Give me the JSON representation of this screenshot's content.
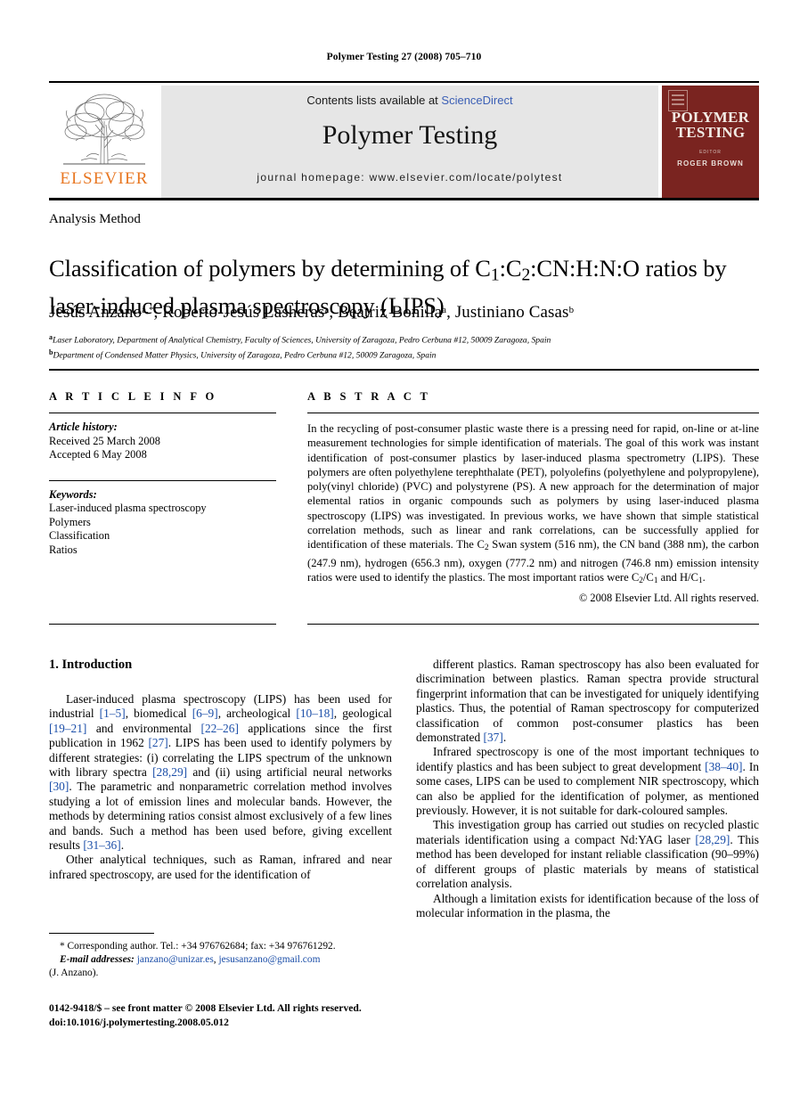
{
  "running_head": "Polymer Testing 27 (2008) 705–710",
  "masthead": {
    "contents_prefix": "Contents lists available at ",
    "sciencedirect": "ScienceDirect",
    "journal_name": "Polymer Testing",
    "homepage": "journal homepage: www.elsevier.com/locate/polytest",
    "publisher_wordmark": "ELSEVIER",
    "cover": {
      "title_line1": "POLYMER",
      "title_line2": "TESTING",
      "editor_label": "EDITOR",
      "editor": "ROGER BROWN"
    },
    "accent_link_color": "#3b5fb5",
    "elsevier_orange": "#E87722",
    "cover_color": "#7a2420"
  },
  "article": {
    "section_label": "Analysis Method",
    "title_part1": "Classification of polymers by determining of C",
    "title_sub1": "1",
    "title_part2": ":C",
    "title_sub2": "2",
    "title_part3": ":CN:H:N:O ratios by laser-induced plasma spectroscopy (LIPS)",
    "authors": [
      {
        "name": "Jesús Anzano",
        "marks": "a,*"
      },
      {
        "name": "Roberto-Jesús Lasheras",
        "marks": "a"
      },
      {
        "name": "Beatriz Bonilla",
        "marks": "a"
      },
      {
        "name": "Justiniano Casas",
        "marks": "b"
      }
    ],
    "affiliations": [
      {
        "mark": "a",
        "text": "Laser Laboratory, Department of Analytical Chemistry, Faculty of Sciences, University of Zaragoza, Pedro Cerbuna #12, 50009 Zaragoza, Spain"
      },
      {
        "mark": "b",
        "text": "Department of Condensed Matter Physics, University of Zaragoza, Pedro Cerbuna #12, 50009 Zaragoza, Spain"
      }
    ]
  },
  "info": {
    "heading": "A R T I C L E   I N F O",
    "history_label": "Article history:",
    "received": "Received 25 March 2008",
    "accepted": "Accepted 6 May 2008",
    "keywords_label": "Keywords:",
    "keywords": [
      "Laser-induced plasma spectroscopy",
      "Polymers",
      "Classification",
      "Ratios"
    ]
  },
  "abstract": {
    "heading": "A B S T R A C T",
    "p1_a": "In the recycling of post-consumer plastic waste there is a pressing need for rapid, on-line or at-line measurement technologies for simple identification of materials. The goal of this work was instant identification of post-consumer plastics by laser-induced plasma spectrometry (LIPS). These polymers are often polyethylene terephthalate (PET), polyolefins (polyethylene and polypropylene), poly(vinyl chloride) (PVC) and polystyrene (PS). A new approach for the determination of major elemental ratios in organic compounds such as polymers by using laser-induced plasma spectroscopy (LIPS) was investigated. In previous works, we have shown that simple statistical correlation methods, such as linear and rank correlations, can be successfully applied for identification of these materials. The C",
    "p1_sub1": "2",
    "p1_b": " Swan system (516 nm), the CN band (388 nm), the carbon (247.9 nm), hydrogen (656.3 nm), oxygen (777.2 nm) and nitrogen (746.8 nm) emission intensity ratios were used to identify the plastics. The most important ratios were C",
    "p1_sub2": "2",
    "p1_c": "/C",
    "p1_sub3": "1",
    "p1_d": " and H/C",
    "p1_sub4": "1",
    "p1_e": ".",
    "copyright": "© 2008 Elsevier Ltd. All rights reserved."
  },
  "body": {
    "intro_heading": "1. Introduction",
    "left": {
      "p1_a": "Laser-induced plasma spectroscopy (LIPS) has been used for industrial ",
      "p1_r1": "[1–5]",
      "p1_b": ", biomedical ",
      "p1_r2": "[6–9]",
      "p1_c": ", archeological ",
      "p1_r3": "[10–18]",
      "p1_d": ", geological ",
      "p1_r4": "[19–21]",
      "p1_e": " and environmental ",
      "p1_r5": "[22–26]",
      "p1_f": " applications since the first publication in 1962 ",
      "p1_r6": "[27]",
      "p1_g": ". LIPS has been used to identify polymers by different strategies: (i) correlating the LIPS spectrum of the unknown with library spectra ",
      "p1_r7": "[28,29]",
      "p1_h": " and (ii) using artificial neural networks ",
      "p1_r8": "[30]",
      "p1_i": ". The parametric and nonparametric correlation method involves studying a lot of emission lines and molecular bands. However, the methods by determining ratios consist almost exclusively of a few lines and bands. Such a method has been used before, giving excellent results ",
      "p1_r9": "[31–36]",
      "p1_j": ".",
      "p2": "Other analytical techniques, such as Raman, infrared and near infrared spectroscopy, are used for the identification of"
    },
    "right": {
      "p1_a": "different plastics. Raman spectroscopy has also been evaluated for discrimination between plastics. Raman spectra provide structural fingerprint information that can be investigated for uniquely identifying plastics. Thus, the potential of Raman spectroscopy for computerized classification of common post-consumer plastics has been demonstrated ",
      "p1_r1": "[37]",
      "p1_b": ".",
      "p2_a": "Infrared spectroscopy is one of the most important techniques to identify plastics and has been subject to great development ",
      "p2_r1": "[38–40]",
      "p2_b": ". In some cases, LIPS can be used to complement NIR spectroscopy, which can also be applied for the identification of polymer, as mentioned previously. However, it is not suitable for dark-coloured samples.",
      "p3_a": "This investigation group has carried out studies on recycled plastic materials identification using a compact Nd:YAG laser ",
      "p3_r1": "[28,29]",
      "p3_b": ". This method has been developed for instant reliable classification (90–99%) of different groups of plastic materials by means of statistical correlation analysis.",
      "p4": "Although a limitation exists for identification because of the loss of molecular information in the plasma, the"
    }
  },
  "footnote": {
    "corresponding": "* Corresponding author. Tel.: +34 976762684; fax: +34 976761292.",
    "email_label": "E-mail addresses:",
    "email1": "janzano@unizar.es",
    "email_sep": ", ",
    "email2": "jesusanzano@gmail.com",
    "email_owner": "(J. Anzano)."
  },
  "imprint": {
    "line1": "0142-9418/$ – see front matter © 2008 Elsevier Ltd. All rights reserved.",
    "line2": "doi:10.1016/j.polymertesting.2008.05.012"
  }
}
